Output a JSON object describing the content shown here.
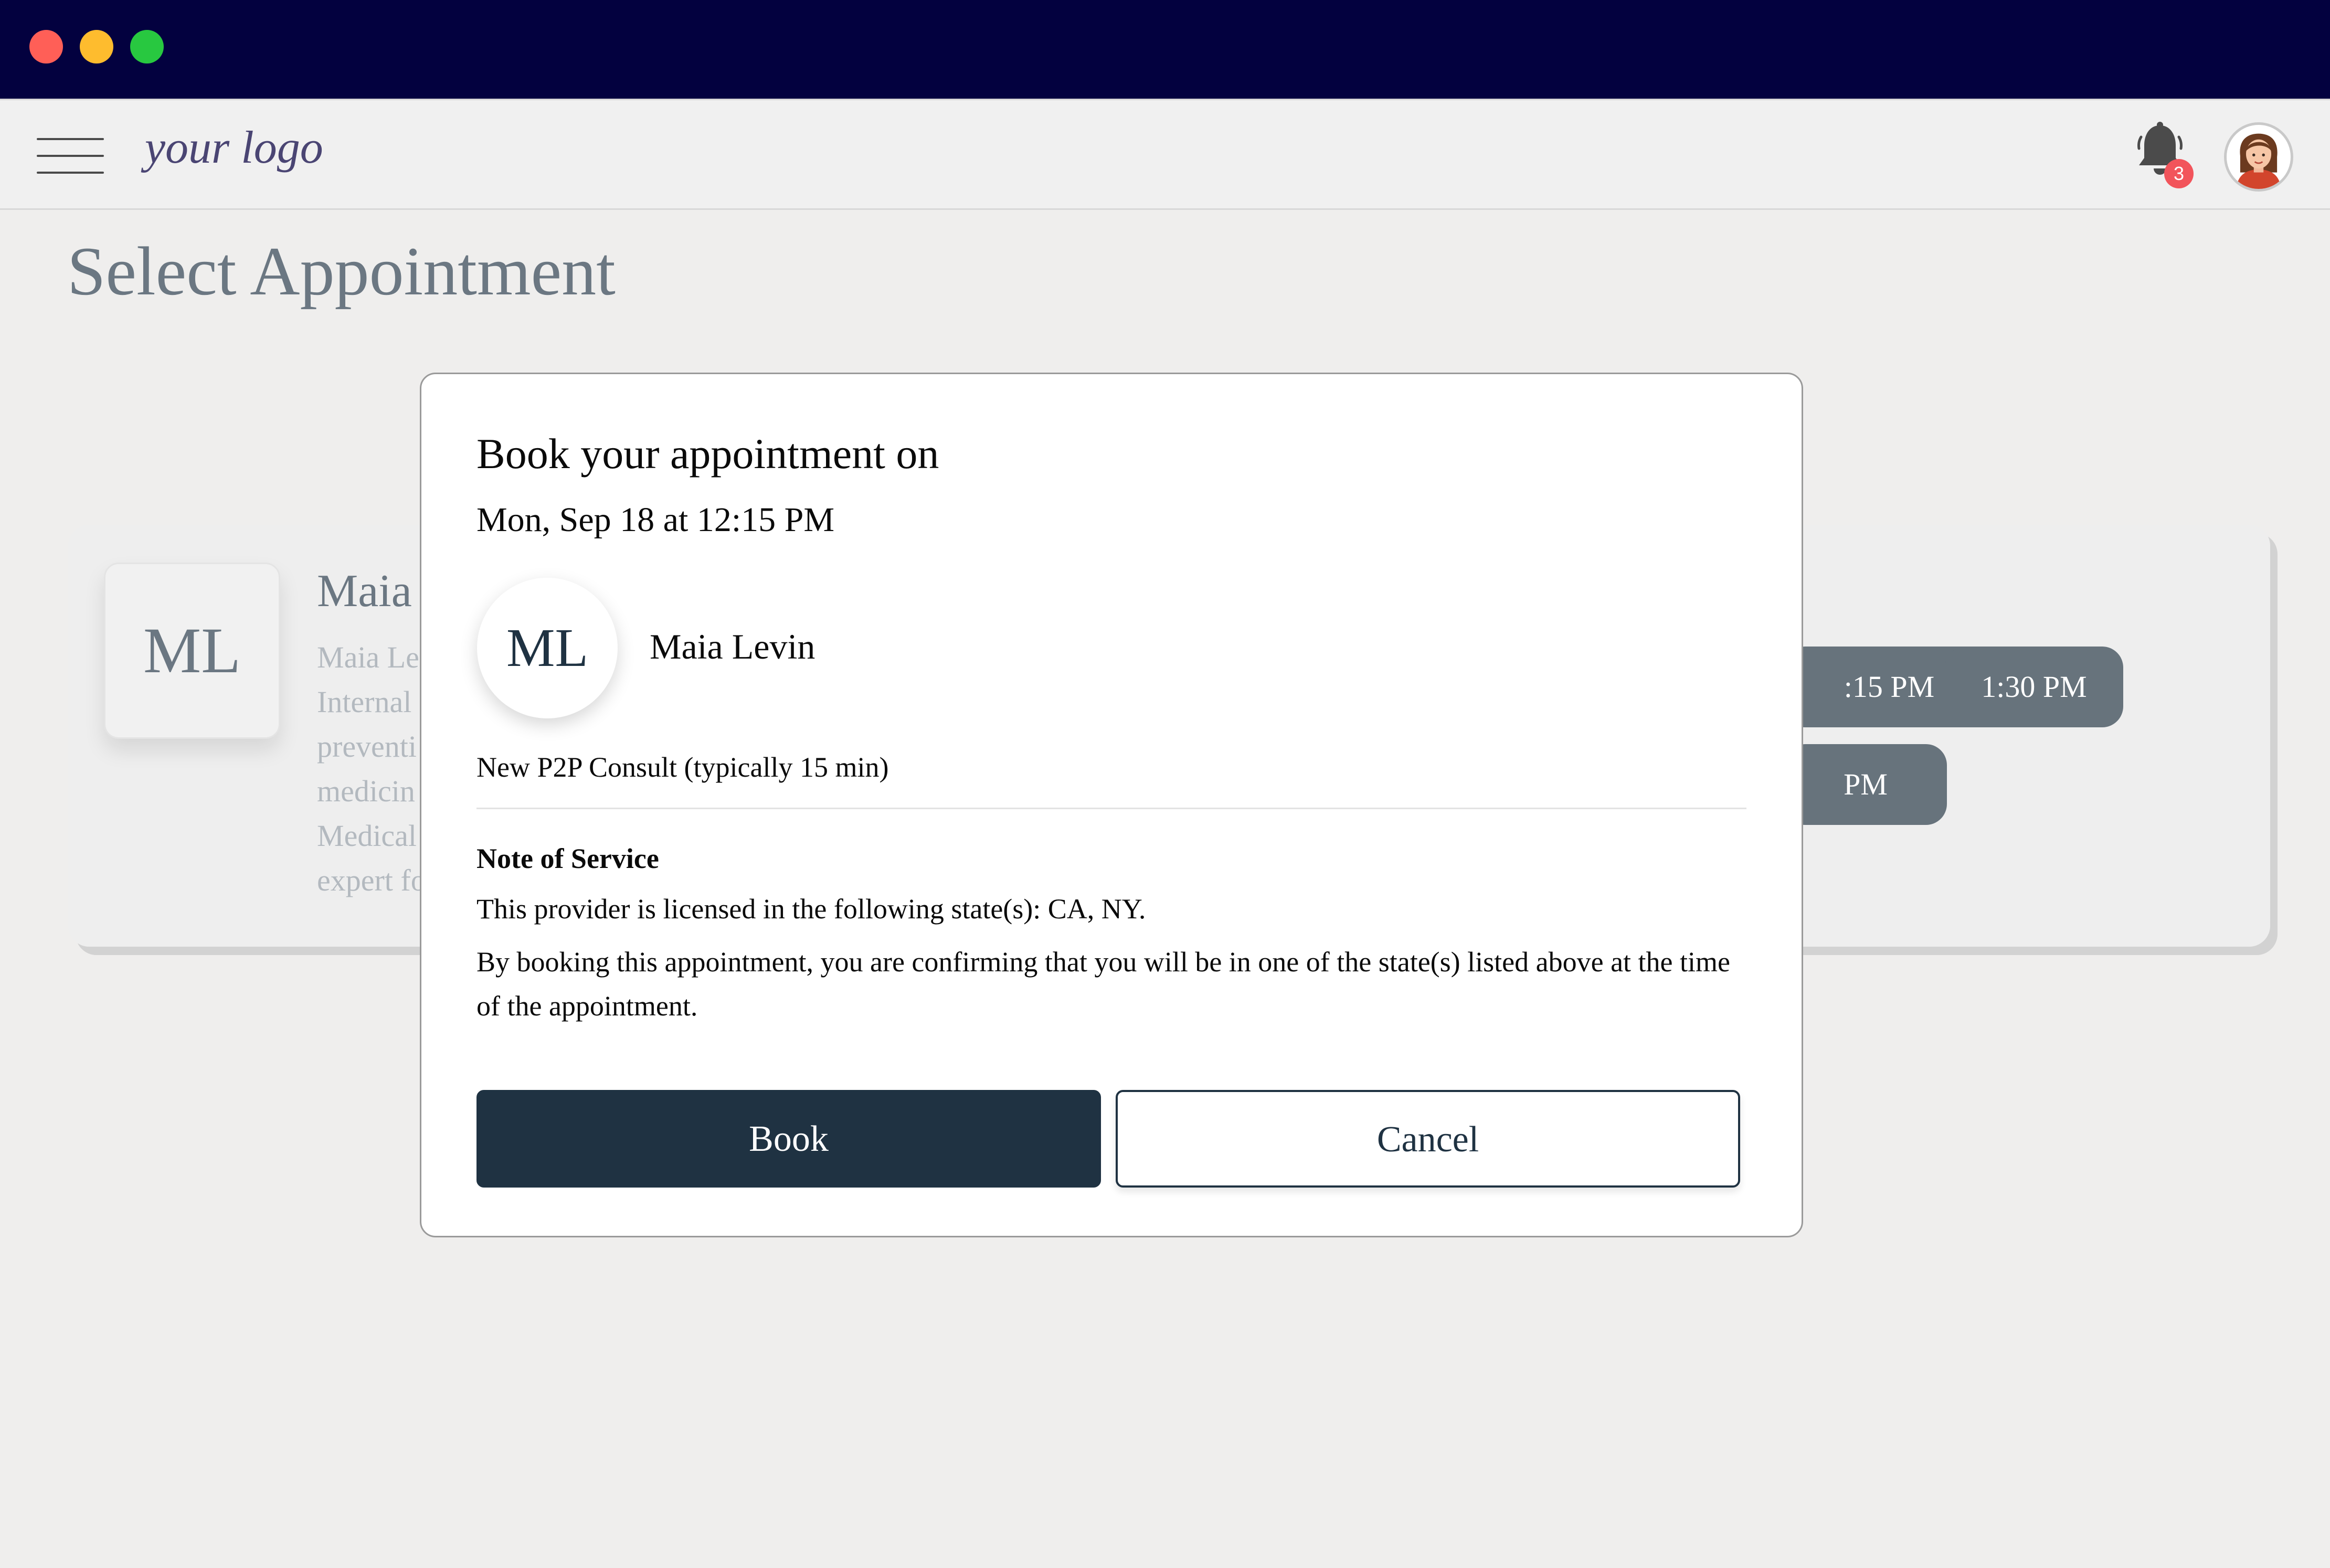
{
  "window": {
    "traffic_lights": [
      "close",
      "minimize",
      "zoom"
    ],
    "colors": {
      "titlebar": "#03013f",
      "close": "#ff5f57",
      "minimize": "#febc2e",
      "zoom": "#28c840"
    }
  },
  "header": {
    "logo_text": "your logo",
    "notifications": {
      "count": "3",
      "icon": "bell-icon"
    },
    "avatar_icon": "user-avatar-icon"
  },
  "page": {
    "title": "Select Appointment"
  },
  "provider_card": {
    "initials": "ML",
    "name_partial": "Maia",
    "description_lines": [
      "Maia Le",
      "Internal",
      "preventi",
      "medicin",
      "Medical",
      "expert fo"
    ],
    "time_slots": [
      ":15 PM",
      "1:30 PM",
      "PM"
    ]
  },
  "modal": {
    "title": "Book your appointment on",
    "date_line": "Mon, Sep 18 at 12:15 PM",
    "provider_initials": "ML",
    "provider_name": "Maia Levin",
    "service": "New P2P Consult (typically 15 min)",
    "note_title": "Note of Service",
    "note_line_1": "This provider is licensed in the following state(s): CA, NY.",
    "note_line_2": "By booking this appointment, you are confirming that you will be in one of the state(s) listed above at the time of the appointment.",
    "book_label": "Book",
    "cancel_label": "Cancel"
  },
  "colors": {
    "primary": "#1f3242",
    "slot": "#67737c",
    "muted_text": "#6b7782",
    "badge": "#f2545b"
  }
}
